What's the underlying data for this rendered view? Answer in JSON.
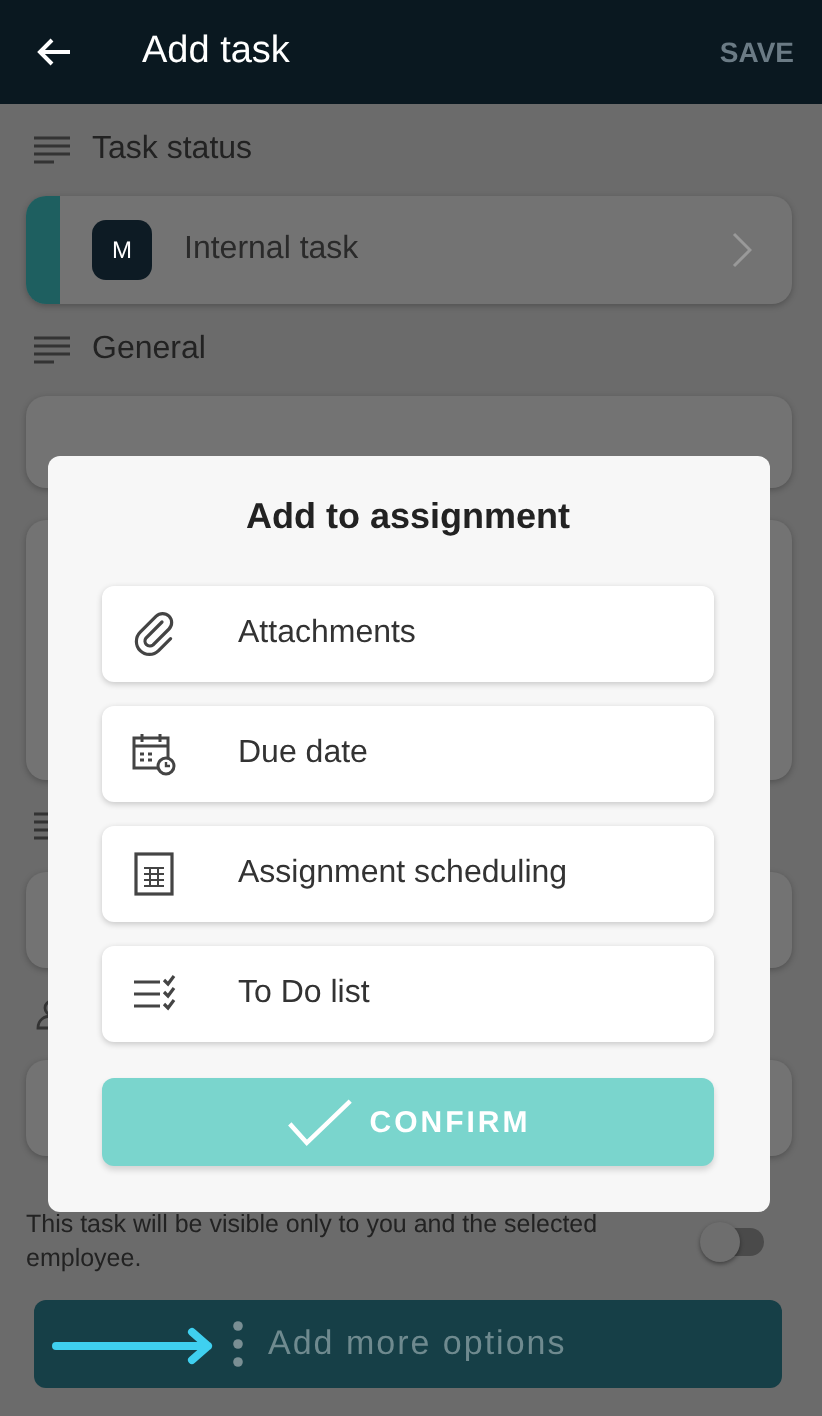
{
  "app_bar": {
    "title": "Add task",
    "save": {
      "label": "SAVE",
      "disabled": true
    }
  },
  "sections": [
    {
      "title": "Task status"
    },
    {
      "title": "General"
    }
  ],
  "status_card": {
    "badge": "M",
    "label": "Internal task",
    "color": "#1e5f60"
  },
  "visibility": {
    "text": "This task will be visible only to you and the selected employee.",
    "on": false
  },
  "more_button": {
    "label": "Add more options"
  },
  "dialog": {
    "title": "Add to assignment",
    "options": [
      {
        "kind": "attachment",
        "label": "Attachments"
      },
      {
        "kind": "date",
        "label": "Due date"
      },
      {
        "kind": "schedule",
        "label": "Assignment scheduling"
      },
      {
        "kind": "checklist",
        "label": "To Do list"
      }
    ],
    "confirm": "CONFIRM"
  }
}
